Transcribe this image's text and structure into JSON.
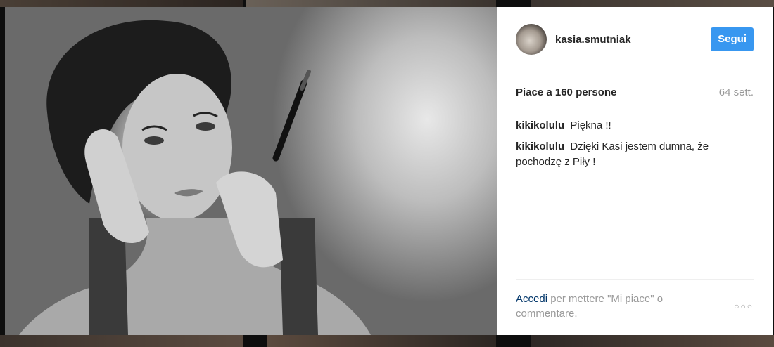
{
  "post": {
    "image_alt": "Black and white portrait of a woman holding a makeup brush",
    "account": {
      "username": "kasia.smutniak"
    },
    "follow_label": "Segui",
    "likes_text": "Piace a 160 persone",
    "time_ago": "64 sett.",
    "comments": [
      {
        "author": "kikikolulu",
        "text": "Piękna !!"
      },
      {
        "author": "kikikolulu",
        "text": "Dzięki Kasi jestem dumna, że pochodzę z Piły !"
      }
    ],
    "login_link": "Accedi",
    "login_rest": " per mettere \"Mi piace\" o commentare.",
    "more_icon": "ellipsis-icon"
  },
  "colors": {
    "follow_button": "#3897f0",
    "link": "#003569",
    "muted": "#999999",
    "text": "#262626"
  }
}
